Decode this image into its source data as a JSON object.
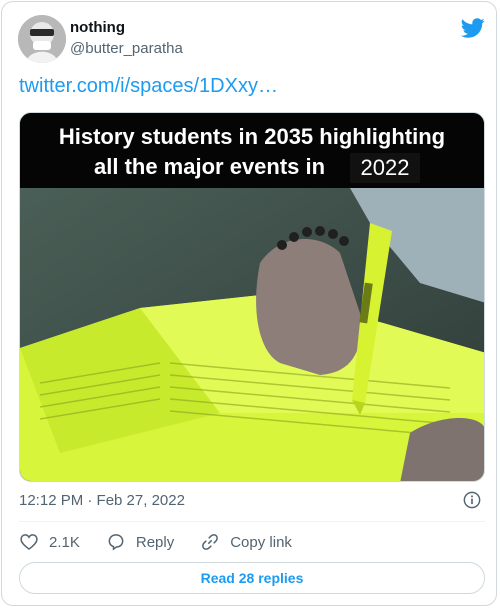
{
  "tweet": {
    "author_name": "nothing",
    "author_handle": "@butter_paratha",
    "link_text": "twitter.com/i/spaces/1DXxy…",
    "timestamp": "12:12 PM · Feb 27, 2022"
  },
  "media": {
    "caption_line1": "History students in 2035 highlighting",
    "caption_line2": "all the major events in",
    "caption_year": "2022"
  },
  "actions": {
    "likes": "2.1K",
    "reply_label": "Reply",
    "copy_label": "Copy link"
  },
  "footer": {
    "read_replies_label": "Read 28 replies"
  },
  "colors": {
    "accent": "#1d9bf0",
    "secondary_text": "#536471",
    "highlighter": "#d7f53a"
  },
  "icons": [
    "twitter-logo-icon",
    "info-icon",
    "heart-icon",
    "reply-icon",
    "link-icon"
  ]
}
